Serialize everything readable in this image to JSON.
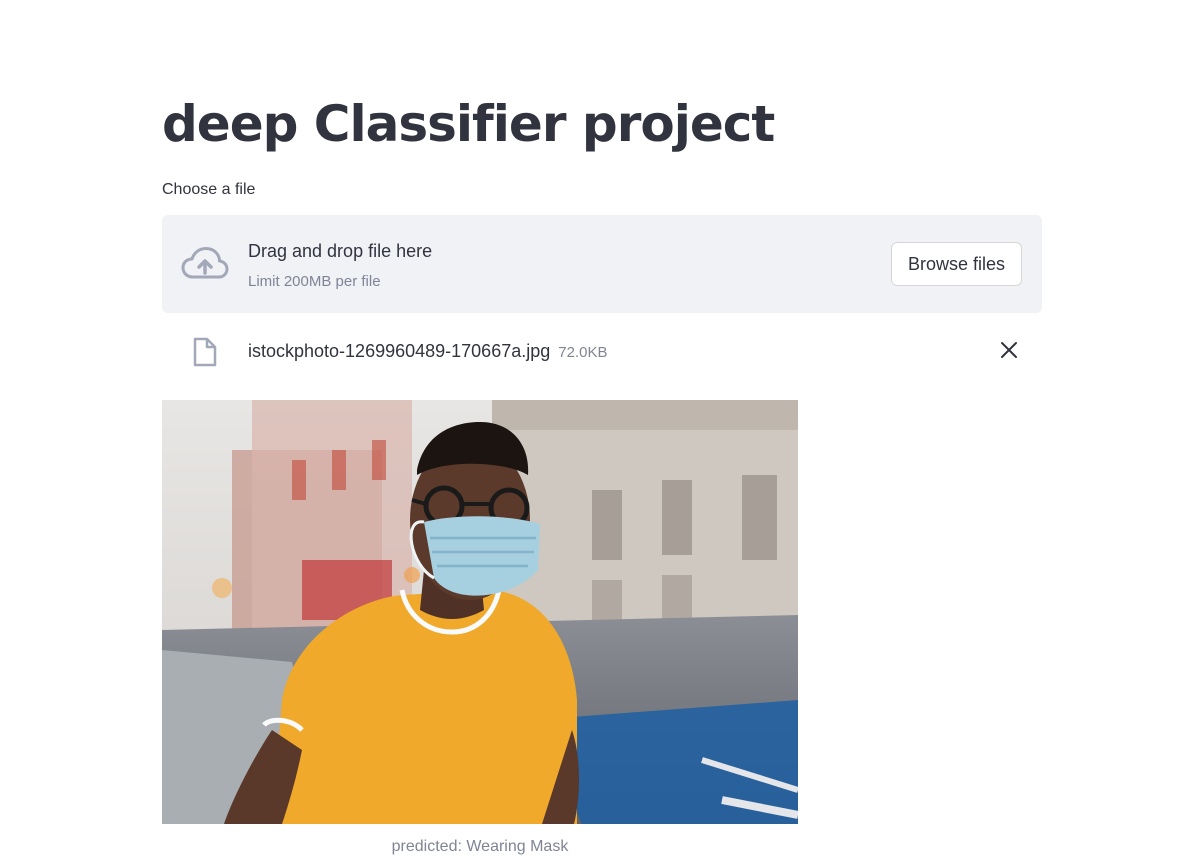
{
  "page": {
    "title": "deep Classifier project"
  },
  "uploader": {
    "label": "Choose a file",
    "dropzone_text": "Drag and drop file here",
    "limit_text": "Limit 200MB per file",
    "browse_label": "Browse files",
    "cloud_icon": "cloud-upload-icon"
  },
  "file": {
    "name": "istockphoto-1269960489-170667a.jpg",
    "size": "72.0KB",
    "icon": "file-icon",
    "remove_icon": "close-icon"
  },
  "image": {
    "caption": "predicted: Wearing Mask"
  },
  "colors": {
    "text": "#31333f",
    "muted": "#808495",
    "dropzone_bg": "#f0f2f6",
    "icon": "#a3a8b8"
  }
}
